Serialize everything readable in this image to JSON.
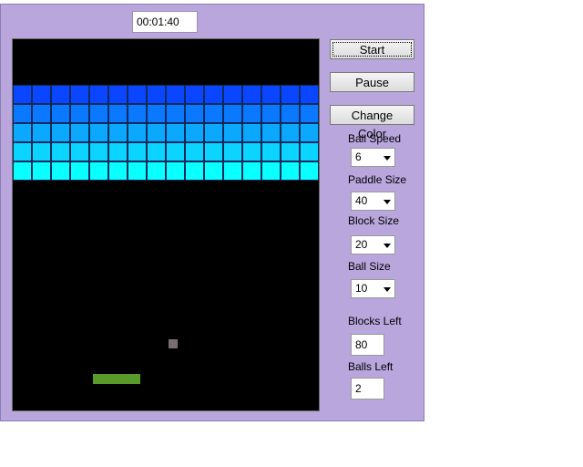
{
  "timer": "00:01:40",
  "buttons": {
    "start": "Start",
    "pause": "Pause",
    "change_color": "Change Color"
  },
  "settings": {
    "ball_speed": {
      "label": "Ball Speed",
      "value": "6"
    },
    "paddle_size": {
      "label": "Paddle Size",
      "value": "40"
    },
    "block_size": {
      "label": "Block Size",
      "value": "20"
    },
    "ball_size": {
      "label": "Ball Size",
      "value": "10"
    }
  },
  "stats": {
    "blocks_left": {
      "label": "Blocks Left",
      "value": "80"
    },
    "balls_left": {
      "label": "Balls Left",
      "value": "2"
    }
  },
  "board": {
    "background": "#000000",
    "block_rows": 5,
    "block_columns": 16,
    "row_colors": [
      "#0a46ff",
      "#0a78ff",
      "#0aa8ff",
      "#0ad4ff",
      "#0affff"
    ],
    "ball_color": "#7a6e74",
    "paddle_color": "#5a9a2a"
  },
  "colors": {
    "window_background": "#b8a6dc"
  }
}
